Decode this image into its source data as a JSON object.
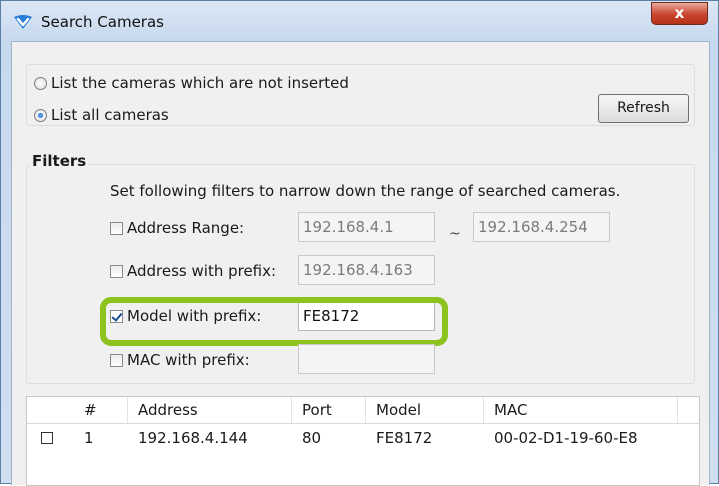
{
  "window": {
    "title": "Search Cameras",
    "close_label": "x"
  },
  "mode": {
    "option_not_inserted": "List the cameras which are not inserted",
    "option_all": "List all cameras",
    "selected": "all",
    "refresh_label": "Refresh"
  },
  "filters": {
    "legend": "Filters",
    "hint": "Set following filters to narrow down the range of searched cameras.",
    "address_range": {
      "label": "Address Range:",
      "checked": false,
      "from": "192.168.4.1",
      "separator": "~",
      "to": "192.168.4.254"
    },
    "address_prefix": {
      "label": "Address with prefix:",
      "checked": false,
      "value": "192.168.4.163"
    },
    "model_prefix": {
      "label": "Model with prefix:",
      "checked": true,
      "value": "FE8172"
    },
    "mac_prefix": {
      "label": "MAC with prefix:",
      "checked": false,
      "value": ""
    }
  },
  "highlight_color": "#8ec21f",
  "table": {
    "columns": [
      "#",
      "Address",
      "Port",
      "Model",
      "MAC"
    ],
    "rows": [
      {
        "checked": false,
        "num": "1",
        "address": "192.168.4.144",
        "port": "80",
        "model": "FE8172",
        "mac": "00-02-D1-19-60-E8"
      }
    ]
  }
}
